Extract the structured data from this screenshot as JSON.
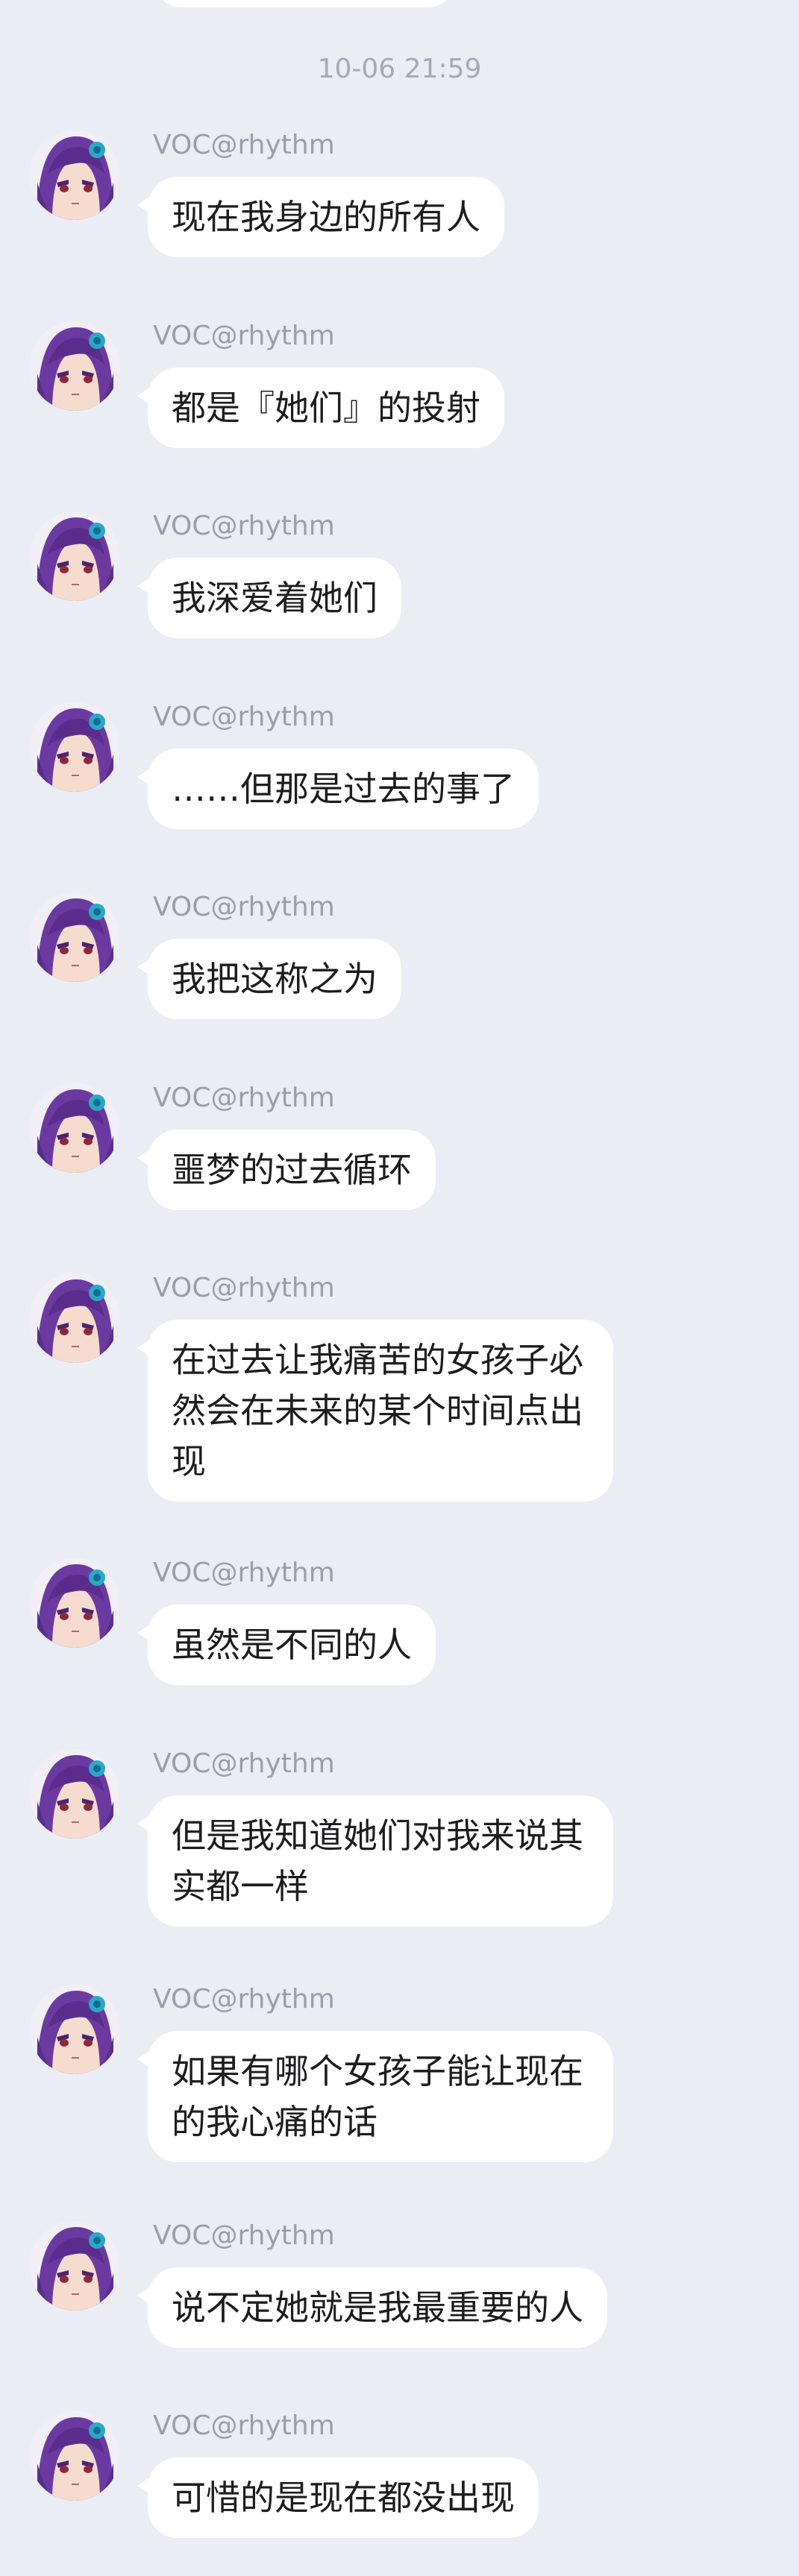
{
  "chat": {
    "timestamp": "10-06 21:59",
    "messages": [
      {
        "sender": "VOC@rhythm",
        "text": "现在我身边的所有人"
      },
      {
        "sender": "VOC@rhythm",
        "text": "都是『她们』的投射"
      },
      {
        "sender": "VOC@rhythm",
        "text": "我深爱着她们"
      },
      {
        "sender": "VOC@rhythm",
        "text": "……但那是过去的事了"
      },
      {
        "sender": "VOC@rhythm",
        "text": "我把这称之为"
      },
      {
        "sender": "VOC@rhythm",
        "text": "噩梦的过去循环"
      },
      {
        "sender": "VOC@rhythm",
        "text": "在过去让我痛苦的女孩子必然会在未来的某个时间点出现"
      },
      {
        "sender": "VOC@rhythm",
        "text": "虽然是不同的人"
      },
      {
        "sender": "VOC@rhythm",
        "text": "但是我知道她们对我来说其实都一样"
      },
      {
        "sender": "VOC@rhythm",
        "text": "如果有哪个女孩子能让现在的我心痛的话"
      },
      {
        "sender": "VOC@rhythm",
        "text": "说不定她就是我最重要的人"
      },
      {
        "sender": "VOC@rhythm",
        "text": "可惜的是现在都没出现"
      }
    ]
  },
  "colors": {
    "background": "#ebedf5",
    "bubble": "#ffffff",
    "sender_name": "#9b9ea8",
    "timestamp": "#a6a9b4",
    "message_text": "#1d1d1f",
    "avatar_hair": "#6b3aa0",
    "avatar_accent": "#2aa7c9"
  },
  "icons": {
    "avatar": "anime-avatar-purple-hair"
  }
}
